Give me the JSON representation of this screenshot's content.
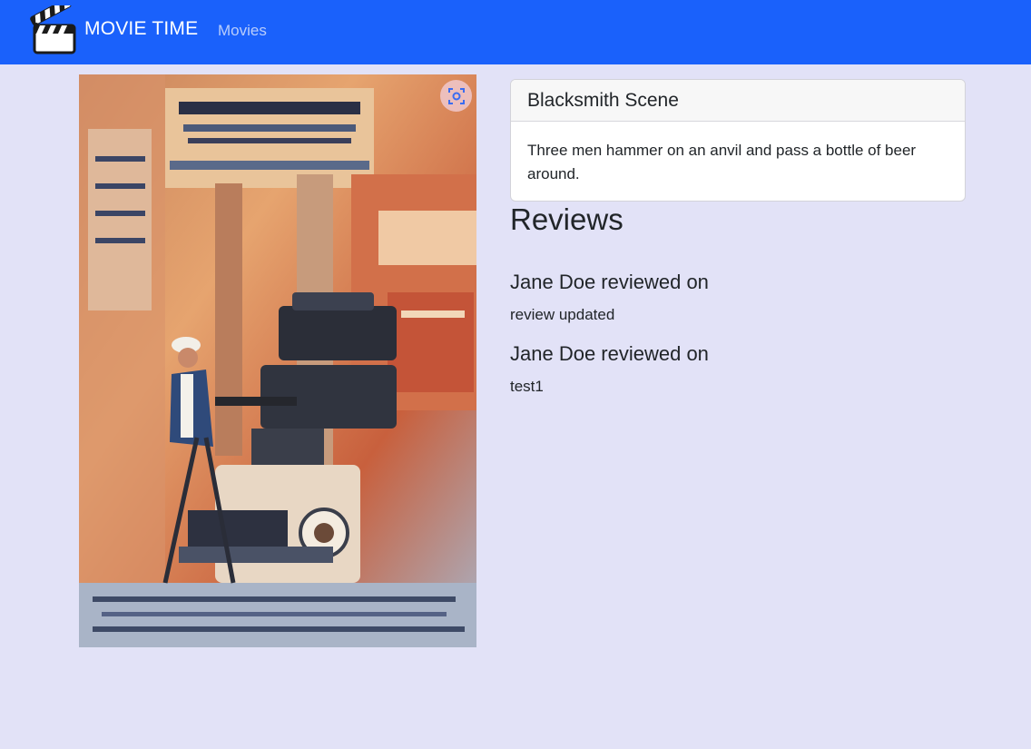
{
  "navbar": {
    "brand": "MOVIE TIME",
    "links": [
      {
        "label": "Movies"
      }
    ],
    "logo_icon": "clapperboard-icon",
    "background": "#1a61fb"
  },
  "poster": {
    "lens_icon": "visual-search-icon"
  },
  "movie": {
    "title": "Blacksmith Scene",
    "description": "Three men hammer on an anvil and pass a bottle of beer around."
  },
  "reviews": {
    "heading": "Reviews",
    "items": [
      {
        "title": "Jane Doe reviewed on",
        "text": "review updated"
      },
      {
        "title": "Jane Doe reviewed on",
        "text": "test1"
      }
    ]
  },
  "colors": {
    "page_background": "#e2e2f7",
    "brand_text": "#ffffff",
    "nav_link": "#b9cdfb"
  }
}
